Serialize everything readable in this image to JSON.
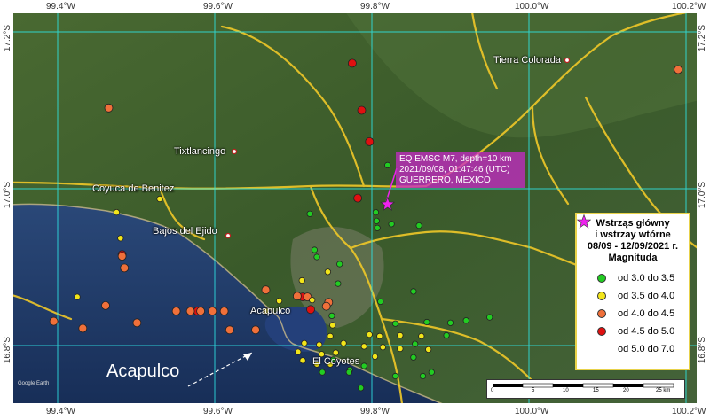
{
  "lat_labels": [
    "17.2°S",
    "17.0°S",
    "16.8°S"
  ],
  "lon_labels": [
    "99.4°W",
    "99.6°W",
    "99.8°W",
    "100.0°W",
    "100.2°W"
  ],
  "places": {
    "tierra_colorada": "Tierra Colorada",
    "tixtlancingo": "Tixtlancingo",
    "coyuca": "Coyuca de Benitez",
    "bajos": "Bajos del Ejido",
    "acapulco_city": "Acapulco",
    "el_coyotes": "El Coyotes"
  },
  "annotation": "Acapulco",
  "map_credit": "Google Earth",
  "epicenter_label": {
    "line1": "EQ EMSC M7, depth=10 km",
    "line2": "2021/09/08, 01:47:46 (UTC)",
    "line3": "GUERRERO, MEXICO"
  },
  "legend": {
    "title_line1": "Wstrząs główny",
    "title_line2": "i wstrzay wtórne",
    "title_line3": "08/09 - 12/09/2021 r.",
    "title_line4": "Magnituda",
    "items": [
      {
        "label": "od 3.0  do  3.5",
        "color": "#22cc22"
      },
      {
        "label": "od 3.5  do  4.0",
        "color": "#f2e51a"
      },
      {
        "label": "od 4.0  do  4.5",
        "color": "#f0703a"
      },
      {
        "label": "od 4.5  do  5.0",
        "color": "#e01010"
      },
      {
        "label": "od 5.0  do  7.0",
        "color": "#ee22ee"
      }
    ]
  },
  "scale": {
    "ticks": [
      "0",
      "5",
      "10",
      "15",
      "20",
      "25 km"
    ]
  },
  "colors": {
    "grid": "#2ee6e6",
    "roads": "#f0c828",
    "land": "#3c5a28",
    "sea": "#1c3660",
    "legend_border": "#e8d24a",
    "epicenter": "#ee22ee"
  },
  "epicenter": {
    "lon": -99.82,
    "lat": 16.98
  },
  "events": [
    {
      "lon": -99.775,
      "lat": 17.16,
      "mag": 4.7
    },
    {
      "lon": -99.797,
      "lat": 17.06,
      "mag": 4.7
    },
    {
      "lon": -99.787,
      "lat": 17.1,
      "mag": 4.8
    },
    {
      "lon": -99.712,
      "lat": 16.862,
      "mag": 4.6
    },
    {
      "lon": -99.578,
      "lat": 16.844,
      "mag": 4.7
    },
    {
      "lon": -99.482,
      "lat": 16.916,
      "mag": 4.6
    },
    {
      "lon": -99.782,
      "lat": 16.988,
      "mag": 4.7
    },
    {
      "lon": -99.722,
      "lat": 16.846,
      "mag": 4.6
    },
    {
      "lon": -100.19,
      "lat": 17.152,
      "mag": 4.3
    },
    {
      "lon": -99.465,
      "lat": 17.103,
      "mag": 4.2
    },
    {
      "lon": -99.485,
      "lat": 16.899,
      "mag": 4.2
    },
    {
      "lon": -99.461,
      "lat": 16.851,
      "mag": 4.1
    },
    {
      "lon": -99.551,
      "lat": 16.844,
      "mag": 4.2
    },
    {
      "lon": -99.569,
      "lat": 16.844,
      "mag": 4.3
    },
    {
      "lon": -99.582,
      "lat": 16.844,
      "mag": 4.2
    },
    {
      "lon": -99.597,
      "lat": 16.844,
      "mag": 4.1
    },
    {
      "lon": -99.612,
      "lat": 16.844,
      "mag": 4.2
    },
    {
      "lon": -99.652,
      "lat": 16.82,
      "mag": 4.3
    },
    {
      "lon": -99.619,
      "lat": 16.82,
      "mag": 4.1
    },
    {
      "lon": -99.665,
      "lat": 16.871,
      "mag": 4.2
    },
    {
      "lon": -99.705,
      "lat": 16.863,
      "mag": 4.2
    },
    {
      "lon": -99.745,
      "lat": 16.855,
      "mag": 4.1
    },
    {
      "lon": -99.718,
      "lat": 16.862,
      "mag": 4.2
    },
    {
      "lon": -99.742,
      "lat": 16.85,
      "mag": 4.3
    },
    {
      "lon": -99.395,
      "lat": 16.831,
      "mag": 4.2
    },
    {
      "lon": -99.432,
      "lat": 16.822,
      "mag": 4.1
    },
    {
      "lon": -99.501,
      "lat": 16.829,
      "mag": 4.3
    },
    {
      "lon": -99.482,
      "lat": 16.914,
      "mag": 4.2
    },
    {
      "lon": -99.82,
      "lat": 17.03,
      "mag": 3.2
    },
    {
      "lon": -99.805,
      "lat": 16.97,
      "mag": 3.1
    },
    {
      "lon": -99.806,
      "lat": 16.959,
      "mag": 3.3
    },
    {
      "lon": -99.807,
      "lat": 16.95,
      "mag": 3.2
    },
    {
      "lon": -99.825,
      "lat": 16.955,
      "mag": 3.4
    },
    {
      "lon": -99.86,
      "lat": 16.953,
      "mag": 3.1
    },
    {
      "lon": -99.721,
      "lat": 16.968,
      "mag": 3.2
    },
    {
      "lon": -99.727,
      "lat": 16.922,
      "mag": 3.3
    },
    {
      "lon": -99.73,
      "lat": 16.913,
      "mag": 3.1
    },
    {
      "lon": -99.759,
      "lat": 16.904,
      "mag": 3.2
    },
    {
      "lon": -99.757,
      "lat": 16.879,
      "mag": 3.4
    },
    {
      "lon": -99.811,
      "lat": 16.856,
      "mag": 3.2
    },
    {
      "lon": -99.853,
      "lat": 16.869,
      "mag": 3.1
    },
    {
      "lon": -99.749,
      "lat": 16.838,
      "mag": 3.3
    },
    {
      "lon": -99.855,
      "lat": 16.802,
      "mag": 3.2
    },
    {
      "lon": -99.95,
      "lat": 16.836,
      "mag": 3.1
    },
    {
      "lon": -99.83,
      "lat": 16.828,
      "mag": 3.2
    },
    {
      "lon": -99.87,
      "lat": 16.83,
      "mag": 3.3
    },
    {
      "lon": -99.9,
      "lat": 16.829,
      "mag": 3.2
    },
    {
      "lon": -99.92,
      "lat": 16.832,
      "mag": 3.1
    },
    {
      "lon": -99.895,
      "lat": 16.813,
      "mag": 3.4
    },
    {
      "lon": -99.853,
      "lat": 16.785,
      "mag": 3.2
    },
    {
      "lon": -99.772,
      "lat": 16.769,
      "mag": 3.1
    },
    {
      "lon": -99.79,
      "lat": 16.774,
      "mag": 3.3
    },
    {
      "lon": -99.876,
      "lat": 16.766,
      "mag": 3.2
    },
    {
      "lon": -99.865,
      "lat": 16.761,
      "mag": 3.1
    },
    {
      "lon": -99.83,
      "lat": 16.761,
      "mag": 3.2
    },
    {
      "lon": -99.786,
      "lat": 16.746,
      "mag": 3.3
    },
    {
      "lon": -99.737,
      "lat": 16.766,
      "mag": 3.2
    },
    {
      "lon": -99.771,
      "lat": 16.766,
      "mag": 3.1
    },
    {
      "lon": -99.751,
      "lat": 16.782,
      "mag": 3.2
    },
    {
      "lon": -99.53,
      "lat": 16.987,
      "mag": 3.7
    },
    {
      "lon": -99.475,
      "lat": 16.97,
      "mag": 3.8
    },
    {
      "lon": -99.48,
      "lat": 16.937,
      "mag": 3.6
    },
    {
      "lon": -99.711,
      "lat": 16.883,
      "mag": 3.7
    },
    {
      "lon": -99.682,
      "lat": 16.857,
      "mag": 3.8
    },
    {
      "lon": -99.724,
      "lat": 16.858,
      "mag": 3.6
    },
    {
      "lon": -99.425,
      "lat": 16.862,
      "mag": 3.9
    },
    {
      "lon": -99.744,
      "lat": 16.894,
      "mag": 3.7
    },
    {
      "lon": -99.665,
      "lat": 16.844,
      "mag": 3.8
    },
    {
      "lon": -99.75,
      "lat": 16.826,
      "mag": 3.6
    },
    {
      "lon": -99.747,
      "lat": 16.812,
      "mag": 3.7
    },
    {
      "lon": -99.733,
      "lat": 16.801,
      "mag": 3.8
    },
    {
      "lon": -99.754,
      "lat": 16.791,
      "mag": 3.7
    },
    {
      "lon": -99.714,
      "lat": 16.803,
      "mag": 3.6
    },
    {
      "lon": -99.736,
      "lat": 16.789,
      "mag": 3.9
    },
    {
      "lon": -99.747,
      "lat": 16.776,
      "mag": 3.7
    },
    {
      "lon": -99.73,
      "lat": 16.776,
      "mag": 3.8
    },
    {
      "lon": -99.797,
      "lat": 16.814,
      "mag": 3.6
    },
    {
      "lon": -99.81,
      "lat": 16.812,
      "mag": 3.7
    },
    {
      "lon": -99.836,
      "lat": 16.813,
      "mag": 3.8
    },
    {
      "lon": -99.863,
      "lat": 16.812,
      "mag": 3.6
    },
    {
      "lon": -99.79,
      "lat": 16.799,
      "mag": 3.7
    },
    {
      "lon": -99.814,
      "lat": 16.798,
      "mag": 3.9
    },
    {
      "lon": -99.836,
      "lat": 16.796,
      "mag": 3.7
    },
    {
      "lon": -99.872,
      "lat": 16.795,
      "mag": 3.8
    },
    {
      "lon": -99.804,
      "lat": 16.786,
      "mag": 3.6
    },
    {
      "lon": -99.764,
      "lat": 16.803,
      "mag": 3.7
    },
    {
      "lon": -99.706,
      "lat": 16.792,
      "mag": 3.8
    },
    {
      "lon": -99.712,
      "lat": 16.781,
      "mag": 3.6
    }
  ]
}
